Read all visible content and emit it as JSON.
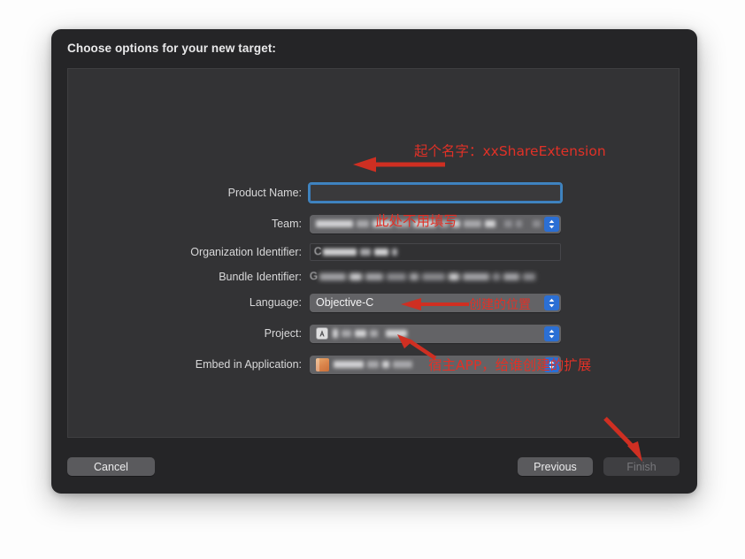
{
  "window": {
    "title": "Choose options for your new target:"
  },
  "form": {
    "rows": [
      {
        "label": "Product Name:",
        "type": "textfield-focused",
        "value": "",
        "placeholder": ""
      },
      {
        "label": "Team:",
        "type": "popup-redacted",
        "value": ""
      },
      {
        "label": "Organization Identifier:",
        "type": "textfield-redacted",
        "value": "",
        "lead": "C"
      },
      {
        "label": "Bundle Identifier:",
        "type": "static-redacted",
        "value": "",
        "lead": "G"
      },
      {
        "label": "Language:",
        "type": "popup",
        "value": "Objective-C"
      },
      {
        "label": "Project:",
        "type": "popup-icon-redacted",
        "value": "",
        "icon": "xcode-project-icon"
      },
      {
        "label": "Embed in Application:",
        "type": "popup-appicon-redacted",
        "value": "",
        "icon": "app-bundle-icon"
      }
    ]
  },
  "buttons": {
    "cancel": "Cancel",
    "previous": "Previous",
    "finish": "Finish"
  },
  "annotations": [
    {
      "id": "product-name-note",
      "text": "起个名字：xxShareExtension",
      "arrow": "left-arrow-to-product-name"
    },
    {
      "id": "organization-identifier-note",
      "text": "此处不用填写",
      "arrow": "none"
    },
    {
      "id": "project-note",
      "text": "创建的位置",
      "arrow": "left-arrow-to-project"
    },
    {
      "id": "embed-application-note",
      "text": "宿主APP，给谁创建的扩展",
      "arrow": "up-left-arrow-to-embed"
    },
    {
      "id": "finish-note",
      "text": "",
      "arrow": "down-left-arrow-to-finish"
    }
  ],
  "colors": {
    "annotation_red": "#e03127",
    "focus_blue": "#4084bf",
    "stepper_blue": "#2b6fd4",
    "dialog_bg": "#252527",
    "panel_bg": "#333335",
    "popup_bg": "#636366"
  }
}
